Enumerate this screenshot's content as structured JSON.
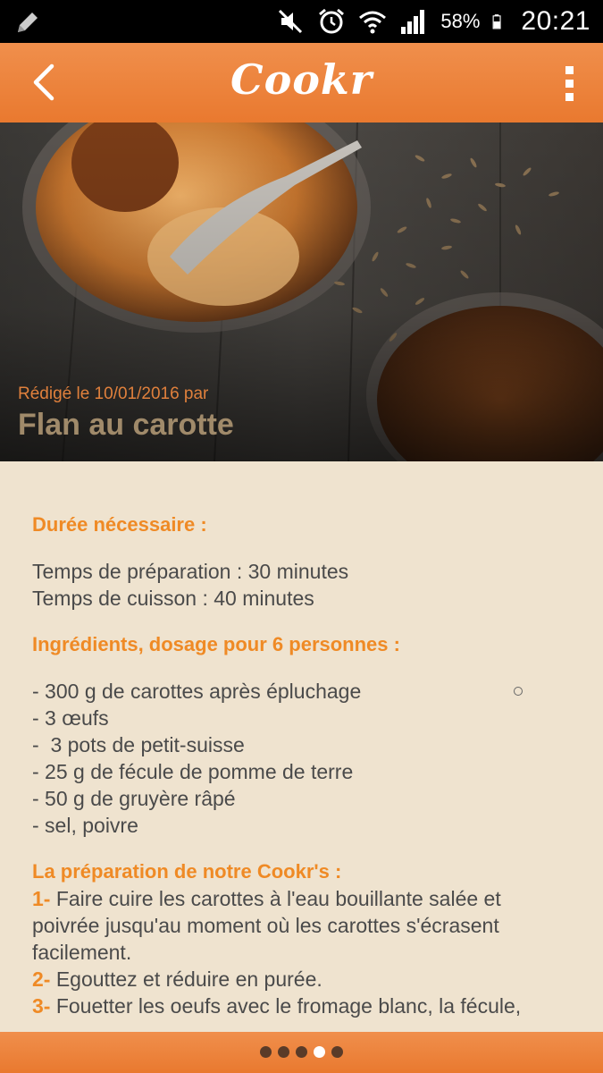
{
  "status_bar": {
    "battery_percent": "58%",
    "time": "20:21",
    "icons": [
      "pencil-icon",
      "mute-icon",
      "alarm-icon",
      "wifi-icon",
      "signal-icon",
      "battery-icon"
    ]
  },
  "app_bar": {
    "title": "Cookr",
    "back_icon": "chevron-left-icon",
    "menu_icon": "more-vert-icon"
  },
  "recipe": {
    "date_line": "Rédigé le 10/01/2016 par",
    "title": "Flan au carotte"
  },
  "duration": {
    "heading": "Durée nécessaire :",
    "lines": [
      "Temps de préparation : 30 minutes",
      "Temps de cuisson : 40 minutes"
    ]
  },
  "ingredients": {
    "heading": "Ingrédients, dosage pour 6 personnes :",
    "items": [
      "- 300 g de carottes après épluchage",
      "- 3 œufs",
      "-  3 pots de petit-suisse",
      "- 25 g de fécule de pomme de terre",
      "- 50 g de gruyère râpé",
      "- sel, poivre"
    ]
  },
  "preparation": {
    "heading": "La préparation de notre Cookr's :",
    "steps": [
      {
        "num": "1-",
        "text": " Faire cuire les carottes à l'eau bouillante salée et poivrée jusqu'au moment où les carottes s'écrasent facilement."
      },
      {
        "num": "2-",
        "text": "Egouttez et réduire en purée."
      },
      {
        "num": "3-",
        "text": " Fouetter les oeufs avec le fromage blanc, la fécule,"
      }
    ]
  },
  "pager": {
    "dot_count": 5,
    "active_index": 3
  },
  "colors": {
    "accent": "#ef8a25",
    "app_bar": "#ec8338",
    "background": "#efe3cf",
    "body_text": "#4a4a4a"
  }
}
